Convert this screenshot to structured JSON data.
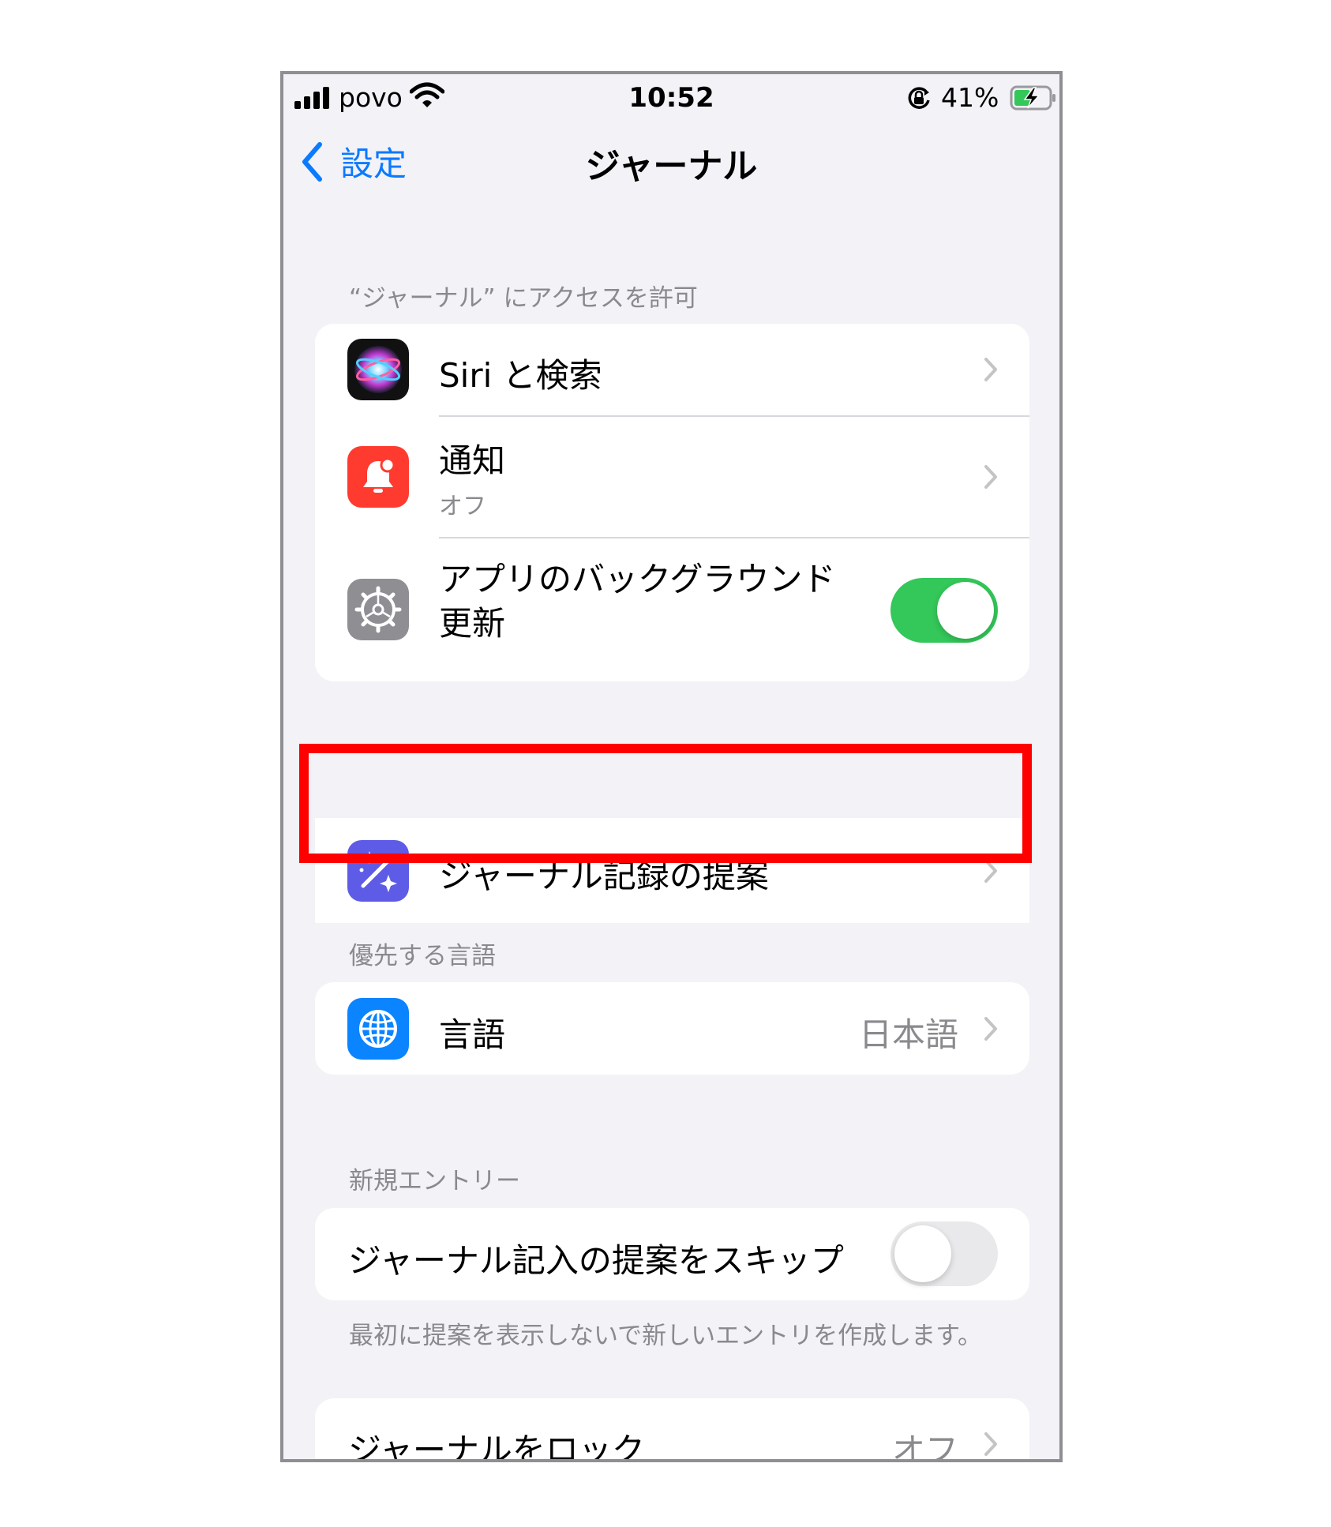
{
  "status_bar": {
    "carrier": "povo",
    "time": "10:52",
    "battery": "41%"
  },
  "nav": {
    "back_label": "設定",
    "title": "ジャーナル"
  },
  "section_access": {
    "header": "“ジャーナル” にアクセスを許可",
    "items": [
      {
        "label": "Siri と検索",
        "icon": "siri-icon"
      },
      {
        "label": "通知",
        "sublabel": "オフ",
        "icon": "notification-bell-icon"
      },
      {
        "label_line1": "アプリのバックグラウンド",
        "label_line2": "更新",
        "icon": "gear-icon",
        "toggle_on": true
      }
    ]
  },
  "suggestions": {
    "label": "ジャーナル記録の提案",
    "icon": "magic-wand-sparkle-icon"
  },
  "section_language": {
    "header": "優先する言語",
    "label": "言語",
    "value": "日本語",
    "icon": "globe-icon"
  },
  "section_new_entry": {
    "header": "新規エントリー",
    "skip_label": "ジャーナル記入の提案をスキップ",
    "skip_toggle_on": false,
    "footer": "最初に提案を表示しないで新しいエントリを作成します。"
  },
  "lock": {
    "label": "ジャーナルをロック",
    "value": "オフ"
  },
  "colors": {
    "accent": "#0a7aff",
    "toggle_on": "#34c759",
    "toggle_off": "#e9e9eb",
    "highlight": "#ff0000",
    "notification_icon_bg": "#ff3b30",
    "settings_icon_bg": "#8e8e93",
    "suggestions_icon_bg": "#5e5ce6",
    "language_icon_bg": "#0a84ff"
  }
}
